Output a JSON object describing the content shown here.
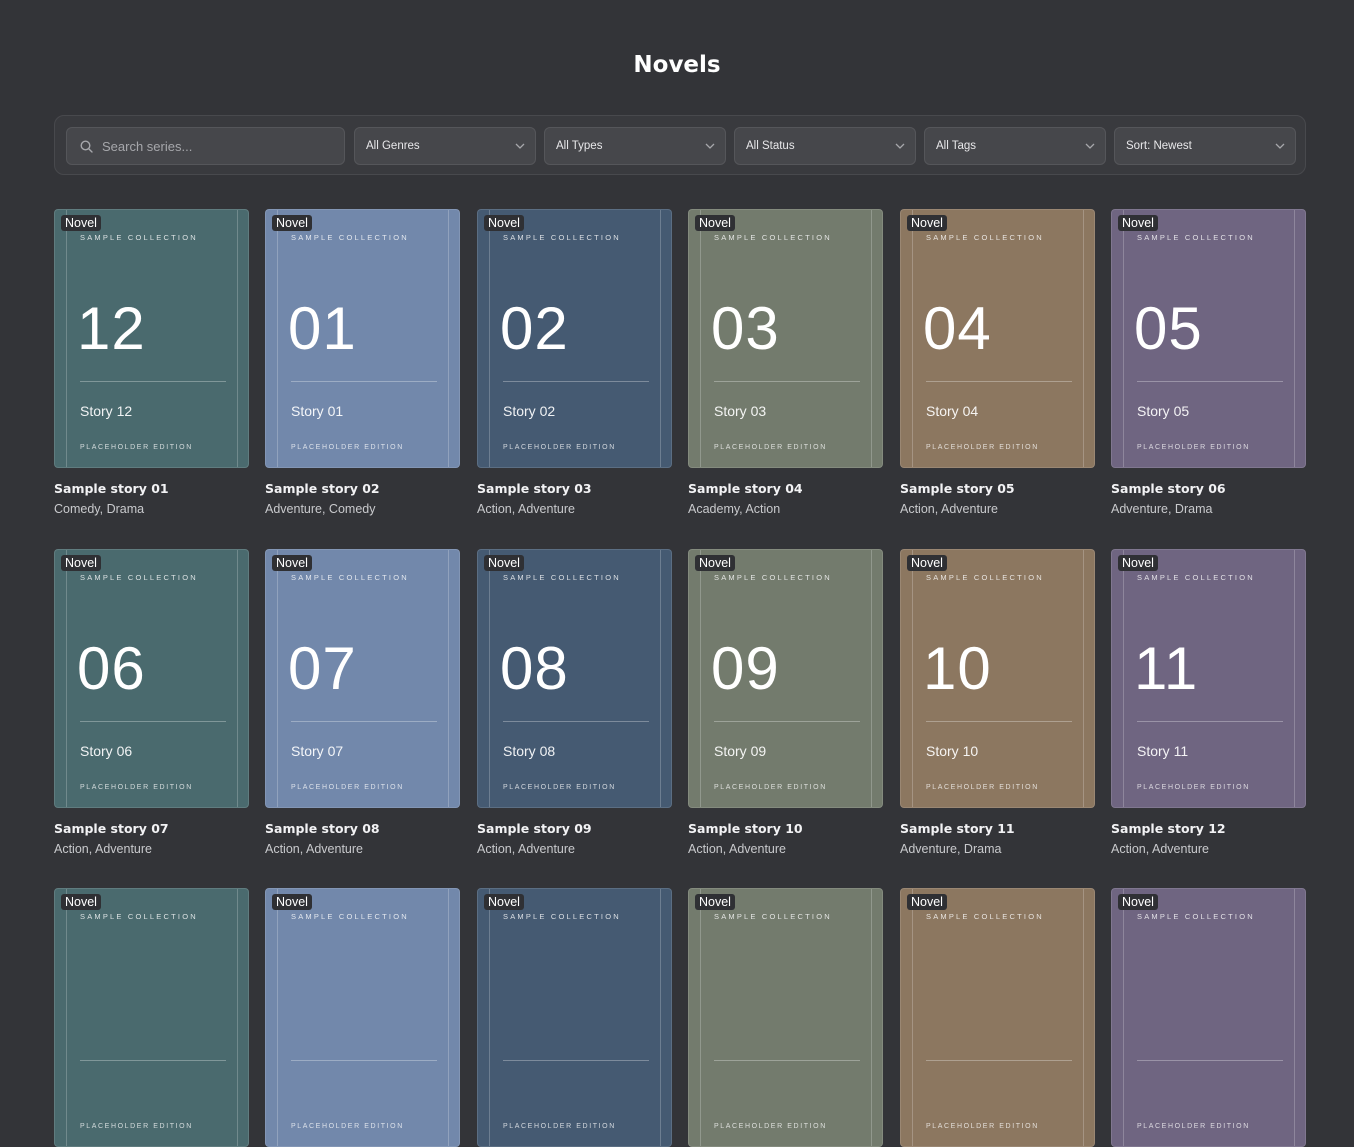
{
  "page": {
    "title": "Novels"
  },
  "filters": {
    "search_placeholder": "Search series...",
    "genres": "All Genres",
    "types": "All Types",
    "status": "All Status",
    "tags": "All Tags",
    "sort": "Sort: Newest"
  },
  "cover_text": {
    "collection": "SAMPLE COLLECTION",
    "edition": "PLACEHOLDER EDITION",
    "badge": "Novel"
  },
  "palette": [
    "#4a6a6e",
    "#7288ab",
    "#455a72",
    "#737b6d",
    "#8c7760",
    "#6f6581"
  ],
  "cards": [
    {
      "number": "12",
      "story": "Story 12",
      "title": "Sample story 01",
      "genres": "Comedy, Drama"
    },
    {
      "number": "01",
      "story": "Story 01",
      "title": "Sample story 02",
      "genres": "Adventure, Comedy"
    },
    {
      "number": "02",
      "story": "Story 02",
      "title": "Sample story 03",
      "genres": "Action, Adventure"
    },
    {
      "number": "03",
      "story": "Story 03",
      "title": "Sample story 04",
      "genres": "Academy, Action"
    },
    {
      "number": "04",
      "story": "Story 04",
      "title": "Sample story 05",
      "genres": "Action, Adventure"
    },
    {
      "number": "05",
      "story": "Story 05",
      "title": "Sample story 06",
      "genres": "Adventure, Drama"
    },
    {
      "number": "06",
      "story": "Story 06",
      "title": "Sample story 07",
      "genres": "Action, Adventure"
    },
    {
      "number": "07",
      "story": "Story 07",
      "title": "Sample story 08",
      "genres": "Action, Adventure"
    },
    {
      "number": "08",
      "story": "Story 08",
      "title": "Sample story 09",
      "genres": "Action, Adventure"
    },
    {
      "number": "09",
      "story": "Story 09",
      "title": "Sample story 10",
      "genres": "Action, Adventure"
    },
    {
      "number": "10",
      "story": "Story 10",
      "title": "Sample story 11",
      "genres": "Adventure, Drama"
    },
    {
      "number": "11",
      "story": "Story 11",
      "title": "Sample story 12",
      "genres": "Action, Adventure"
    },
    {
      "number": "",
      "story": "",
      "title": "",
      "genres": ""
    },
    {
      "number": "",
      "story": "",
      "title": "",
      "genres": ""
    },
    {
      "number": "",
      "story": "",
      "title": "",
      "genres": ""
    },
    {
      "number": "",
      "story": "",
      "title": "",
      "genres": ""
    },
    {
      "number": "",
      "story": "",
      "title": "",
      "genres": ""
    },
    {
      "number": "",
      "story": "",
      "title": "",
      "genres": ""
    }
  ]
}
